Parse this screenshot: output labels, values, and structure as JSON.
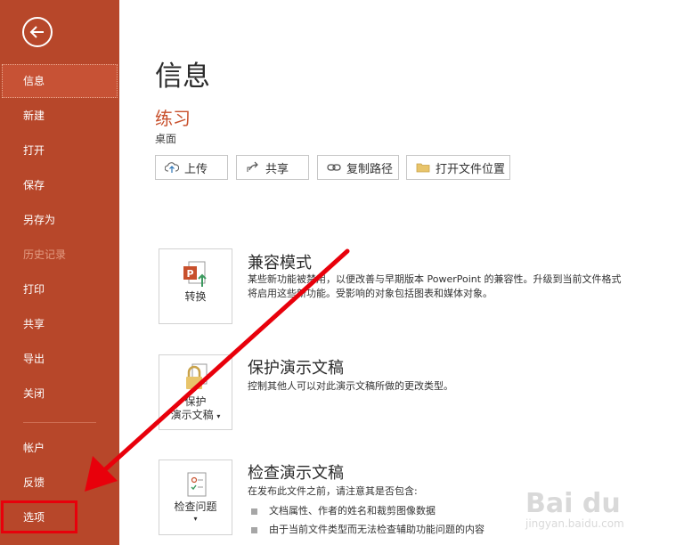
{
  "sidebar": {
    "items": [
      {
        "label": "信息"
      },
      {
        "label": "新建"
      },
      {
        "label": "打开"
      },
      {
        "label": "保存"
      },
      {
        "label": "另存为"
      },
      {
        "label": "历史记录"
      },
      {
        "label": "打印"
      },
      {
        "label": "共享"
      },
      {
        "label": "导出"
      },
      {
        "label": "关闭"
      },
      {
        "label": "帐户"
      },
      {
        "label": "反馈"
      },
      {
        "label": "选项"
      }
    ]
  },
  "main": {
    "title": "信息",
    "doc_name": "练习",
    "doc_path": "桌面",
    "actions": [
      {
        "label": "上传",
        "icon": "cloud-upload-icon"
      },
      {
        "label": "共享",
        "icon": "share-icon"
      },
      {
        "label": "复制路径",
        "icon": "link-icon"
      },
      {
        "label": "打开文件位置",
        "icon": "folder-icon"
      }
    ],
    "sections": {
      "compat": {
        "tile_label": "转换",
        "title": "兼容模式",
        "desc_line1": "某些新功能被禁用，以便改善与早期版本 PowerPoint 的兼容性。升级到当前文件格式",
        "desc_line2": "将启用这些新功能。受影响的对象包括图表和媒体对象。"
      },
      "protect": {
        "tile_label1": "保护",
        "tile_label2": "演示文稿",
        "title": "保护演示文稿",
        "desc": "控制其他人可以对此演示文稿所做的更改类型。"
      },
      "inspect": {
        "tile_label": "检查问题",
        "title": "检查演示文稿",
        "desc": "在发布此文件之前，请注意其是否包含:",
        "bullets": [
          "文档属性、作者的姓名和裁剪图像数据",
          "由于当前文件类型而无法检查辅助功能问题的内容"
        ]
      }
    }
  },
  "annotation": {
    "color": "#e8000b"
  },
  "watermark": {
    "logo": "Bai du",
    "sub": "jingyan.baidu.com"
  }
}
